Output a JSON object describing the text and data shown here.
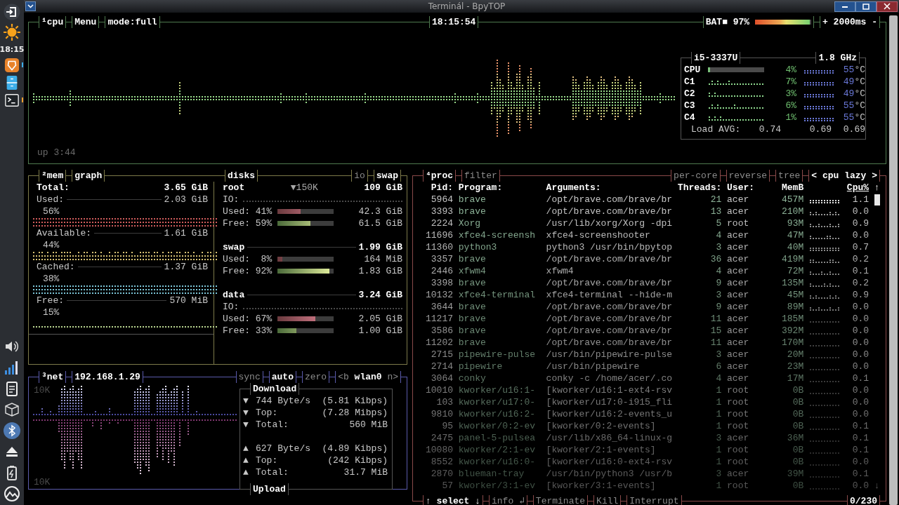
{
  "window": {
    "title": "Terminál - BpyTOP"
  },
  "dock": {
    "top": [
      {
        "kind": "logout"
      },
      {
        "kind": "weather"
      }
    ],
    "clock": "18:15",
    "launchers": [
      {
        "kind": "browser",
        "running": true,
        "color": "#3daee9"
      },
      {
        "kind": "files",
        "running": false
      },
      {
        "kind": "terminal",
        "running": true,
        "color": "#f0a030"
      }
    ],
    "tray": [
      {
        "kind": "volume",
        "active": false
      },
      {
        "kind": "signal",
        "active": false
      },
      {
        "kind": "clipboard",
        "active": false
      },
      {
        "kind": "package",
        "active": false
      },
      {
        "kind": "bluetooth",
        "active": true
      },
      {
        "kind": "eject",
        "active": false
      },
      {
        "kind": "battery",
        "active": false
      },
      {
        "kind": "logo",
        "active": false
      }
    ]
  },
  "cpu": {
    "tabs": [
      {
        "text": "¹cpu",
        "on": true
      },
      {
        "text": "Menu",
        "on": true
      },
      {
        "text": "mode:full",
        "on": true
      }
    ],
    "clock": "18:15:54",
    "battery": {
      "label": "BAT■ 97%",
      "level": 0.97
    },
    "interval": "+ 2000ms -",
    "uptime": "up 3:44",
    "info": {
      "model": "i5-3337U",
      "freq": "1.8 GHz",
      "rows": [
        {
          "label": "CPU",
          "kind": "meter",
          "level": 0.04,
          "percent": "4%",
          "temp": "55",
          "unit": "°C"
        },
        {
          "label": "C1",
          "kind": "graph",
          "percent": "7%",
          "temp": "49",
          "unit": "°C"
        },
        {
          "label": "C2",
          "kind": "graph",
          "percent": "3%",
          "temp": "49",
          "unit": "°C"
        },
        {
          "label": "C3",
          "kind": "graph",
          "percent": "6%",
          "temp": "55",
          "unit": "°C"
        },
        {
          "label": "C4",
          "kind": "graph",
          "percent": "1%",
          "temp": "55",
          "unit": "°C"
        }
      ],
      "load_label": "Load AVG:",
      "load": [
        "0.74",
        "0.69",
        "0.69"
      ]
    }
  },
  "mem": {
    "tabs": [
      {
        "text": "²mem",
        "on": true
      },
      {
        "text": "graph",
        "on": true
      }
    ],
    "disk_tabs": [
      {
        "text": "disks",
        "on": true
      },
      {
        "text": "io",
        "on": false
      },
      {
        "text": "swap",
        "on": true
      }
    ],
    "items": [
      {
        "kind": "total",
        "label": "Total:",
        "value": "3.65 GiB"
      },
      {
        "kind": "stat",
        "label": "Used:",
        "value": "2.03 GiB",
        "percent": "56%",
        "color": "#d05c5c"
      },
      {
        "kind": "stat",
        "label": "Available:",
        "value": "1.61 GiB",
        "percent": "44%",
        "color": "#d8c274"
      },
      {
        "kind": "stat",
        "label": "Cached:",
        "value": "1.37 GiB",
        "percent": "38%",
        "color": "#7cc6d8"
      },
      {
        "kind": "stat",
        "label": "Free:",
        "value": "570 MiB",
        "percent": "15%",
        "color": "#bcd892"
      }
    ],
    "disks": [
      {
        "name": "root",
        "io_rate": "▼150K",
        "size": "109 GiB",
        "io": "IO:",
        "used": {
          "label": "Used:",
          "percent": "41%",
          "level": 0.41,
          "value": "42.3 GiB"
        },
        "free": {
          "label": "Free:",
          "percent": "59%",
          "level": 0.59,
          "value": "61.5 GiB"
        }
      },
      {
        "name": "swap",
        "size": "1.99 GiB",
        "used": {
          "label": "Used:",
          "percent": "8%",
          "level": 0.08,
          "value": "164 MiB"
        },
        "free": {
          "label": "Free:",
          "percent": "92%",
          "level": 0.92,
          "value": "1.83 GiB"
        }
      },
      {
        "name": "data",
        "size": "3.24 GiB",
        "io": "IO:",
        "used": {
          "label": "Used:",
          "percent": "67%",
          "level": 0.67,
          "value": "2.05 GiB"
        },
        "free": {
          "label": "Free:",
          "percent": "33%",
          "level": 0.33,
          "value": "1.00 GiB"
        }
      }
    ]
  },
  "net": {
    "tabs": [
      {
        "text": "³net",
        "on": true
      },
      {
        "text": "192.168.1.29",
        "on": true
      }
    ],
    "options": [
      {
        "text": "sync",
        "on": false
      },
      {
        "text": "auto",
        "on": true
      },
      {
        "text": "zero",
        "on": false
      },
      {
        "text": "<b **wlan0** n>",
        "on": false
      }
    ],
    "scale_top": "10K",
    "scale_bottom": "10K",
    "download": {
      "title": "Download",
      "rows": [
        {
          "arrow": "▼",
          "label": "744 Byte/s",
          "value": "(5.81 Kibps)"
        },
        {
          "arrow": "▼",
          "label": "Top:",
          "value": "(7.28 Mibps)"
        },
        {
          "arrow": "▼",
          "label": "Total:",
          "value": "560 MiB"
        }
      ]
    },
    "upload": {
      "title": "Upload",
      "rows": [
        {
          "arrow": "▲",
          "label": "627 Byte/s",
          "value": "(4.89 Kibps)"
        },
        {
          "arrow": "▲",
          "label": "Top:",
          "value": "(242 Kibps)"
        },
        {
          "arrow": "▲",
          "label": "Total:",
          "value": "31.7 MiB"
        }
      ]
    }
  },
  "proc": {
    "tabs": [
      {
        "text": "⁴proc",
        "on": true
      },
      {
        "text": "filter",
        "on": false
      }
    ],
    "options": [
      {
        "text": "per-core",
        "on": false
      },
      {
        "text": "reverse",
        "on": false
      },
      {
        "text": "tree",
        "on": false
      }
    ],
    "sort": {
      "prev": "<",
      "label": "cpu lazy",
      "next": ">"
    },
    "columns": [
      {
        "label": "Pid:",
        "sorted": false
      },
      {
        "label": "Program:",
        "sorted": false
      },
      {
        "label": "Arguments:",
        "sorted": false
      },
      {
        "label": "Threads:",
        "sorted": false
      },
      {
        "label": "User:",
        "sorted": false
      },
      {
        "label": "MemB",
        "sorted": false
      },
      {
        "label": "Cpu%",
        "sorted": true
      }
    ],
    "scroll_up": "↑",
    "scroll_down": "↓",
    "rows": [
      {
        "pid": "5964",
        "program": "brave",
        "args": "/opt/brave.com/brave/br",
        "threads": "21",
        "user": "acer",
        "mem": "457M",
        "cpu": "1.1"
      },
      {
        "pid": "3393",
        "program": "brave",
        "args": "/opt/brave.com/brave/br",
        "threads": "13",
        "user": "acer",
        "mem": "210M",
        "cpu": "0.0"
      },
      {
        "pid": "2224",
        "program": "Xorg",
        "args": "/usr/lib/xorg/Xorg -dpi",
        "threads": "5",
        "user": "root",
        "mem": "93M",
        "cpu": "0.9"
      },
      {
        "pid": "11696",
        "program": "xfce4-screensh",
        "args": "xfce4-screenshooter",
        "threads": "4",
        "user": "acer",
        "mem": "47M",
        "cpu": "0.0"
      },
      {
        "pid": "11360",
        "program": "python3",
        "args": "python3 /usr/bin/bpytop",
        "threads": "3",
        "user": "acer",
        "mem": "40M",
        "cpu": "0.7"
      },
      {
        "pid": "3357",
        "program": "brave",
        "args": "/opt/brave.com/brave/br",
        "threads": "36",
        "user": "acer",
        "mem": "419M",
        "cpu": "0.2"
      },
      {
        "pid": "2446",
        "program": "xfwm4",
        "args": "xfwm4",
        "threads": "4",
        "user": "acer",
        "mem": "72M",
        "cpu": "0.1"
      },
      {
        "pid": "3398",
        "program": "brave",
        "args": "/opt/brave.com/brave/br",
        "threads": "9",
        "user": "acer",
        "mem": "135M",
        "cpu": "0.2"
      },
      {
        "pid": "10132",
        "program": "xfce4-terminal",
        "args": "xfce4-terminal --hide-m",
        "threads": "3",
        "user": "acer",
        "mem": "45M",
        "cpu": "0.9"
      },
      {
        "pid": "3644",
        "program": "brave",
        "args": "/opt/brave.com/brave/br",
        "threads": "9",
        "user": "acer",
        "mem": "89M",
        "cpu": "0.0"
      },
      {
        "pid": "11217",
        "program": "brave",
        "args": "/opt/brave.com/brave/br",
        "threads": "11",
        "user": "acer",
        "mem": "185M",
        "cpu": "0.0"
      },
      {
        "pid": "3586",
        "program": "brave",
        "args": "/opt/brave.com/brave/br",
        "threads": "15",
        "user": "acer",
        "mem": "392M",
        "cpu": "0.0"
      },
      {
        "pid": "11202",
        "program": "brave",
        "args": "/opt/brave.com/brave/br",
        "threads": "11",
        "user": "acer",
        "mem": "170M",
        "cpu": "0.0"
      },
      {
        "pid": "2715",
        "program": "pipewire-pulse",
        "args": "/usr/bin/pipewire-pulse",
        "threads": "3",
        "user": "acer",
        "mem": "20M",
        "cpu": "0.0"
      },
      {
        "pid": "2714",
        "program": "pipewire",
        "args": "/usr/bin/pipewire",
        "threads": "6",
        "user": "acer",
        "mem": "23M",
        "cpu": "0.0"
      },
      {
        "pid": "3064",
        "program": "conky",
        "args": "conky -c /home/acer/.co",
        "threads": "4",
        "user": "acer",
        "mem": "17M",
        "cpu": "0.1"
      },
      {
        "pid": "10010",
        "program": "kworker/u16:1-",
        "args": "[kworker/u16:1-ext4-rsv",
        "threads": "1",
        "user": "root",
        "mem": "0B",
        "cpu": "0.0"
      },
      {
        "pid": "103",
        "program": "kworker/u17:0-",
        "args": "[kworker/u17:0-i915_fli",
        "threads": "1",
        "user": "root",
        "mem": "0B",
        "cpu": "0.0"
      },
      {
        "pid": "9810",
        "program": "kworker/u16:2-",
        "args": "[kworker/u16:2-events_u",
        "threads": "1",
        "user": "root",
        "mem": "0B",
        "cpu": "0.0"
      },
      {
        "pid": "95",
        "program": "kworker/0:2-ev",
        "args": "[kworker/0:2-events]",
        "threads": "1",
        "user": "root",
        "mem": "0B",
        "cpu": "0.1"
      },
      {
        "pid": "2475",
        "program": "panel-5-pulsea",
        "args": "/usr/lib/x86_64-linux-g",
        "threads": "3",
        "user": "acer",
        "mem": "36M",
        "cpu": "0.1"
      },
      {
        "pid": "10080",
        "program": "kworker/2:1-ev",
        "args": "[kworker/2:1-events]",
        "threads": "1",
        "user": "root",
        "mem": "0B",
        "cpu": "0.1"
      },
      {
        "pid": "8552",
        "program": "kworker/u16:0-",
        "args": "[kworker/u16:0-ext4-rsv",
        "threads": "1",
        "user": "root",
        "mem": "0B",
        "cpu": "0.0"
      },
      {
        "pid": "2870",
        "program": "blueman-tray",
        "args": "/usr/bin/python3 /usr/b",
        "threads": "3",
        "user": "acer",
        "mem": "39M",
        "cpu": "0.1"
      },
      {
        "pid": "57",
        "program": "kworker/3:1-ev",
        "args": "[kworker/3:1-events]",
        "threads": "1",
        "user": "root",
        "mem": "0B",
        "cpu": "0.0"
      }
    ],
    "footer": [
      {
        "text": "↑ select ↓",
        "on": true
      },
      {
        "text": "info ↲",
        "on": false
      },
      {
        "text": "Terminate",
        "on": false
      },
      {
        "text": "Kill",
        "on": false
      },
      {
        "text": "Interrupt",
        "on": false
      }
    ],
    "count": "0/230"
  }
}
